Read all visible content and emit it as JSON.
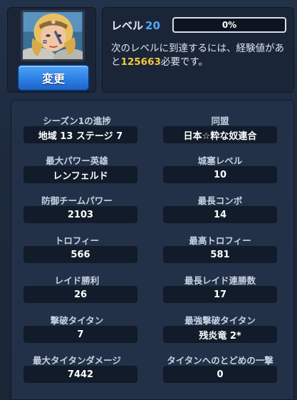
{
  "profile": {
    "change_button": "変更"
  },
  "level": {
    "label": "レベル",
    "value": "20",
    "progress_text": "0%",
    "progress_fraction": 0,
    "desc_prefix": "次のレベルに到達するには、経験値があと",
    "xp_remaining": "125663",
    "desc_suffix": "必要です。"
  },
  "stats": [
    {
      "label": "シーズン1の進捗",
      "value": "地域 13 ステージ 7"
    },
    {
      "label": "同盟",
      "value": "日本☆粋な奴連合"
    },
    {
      "label": "最大パワー英雄",
      "value": "レンフェルド"
    },
    {
      "label": "城塞レベル",
      "value": "10"
    },
    {
      "label": "防御チームパワー",
      "value": "2103"
    },
    {
      "label": "最長コンボ",
      "value": "14"
    },
    {
      "label": "トロフィー",
      "value": "566"
    },
    {
      "label": "最高トロフィー",
      "value": "581"
    },
    {
      "label": "レイド勝利",
      "value": "26"
    },
    {
      "label": "最長レイド連勝数",
      "value": "17"
    },
    {
      "label": "撃破タイタン",
      "value": "7"
    },
    {
      "label": "最強撃破タイタン",
      "value": "残炎竜 2*"
    },
    {
      "label": "最大タイタンダメージ",
      "value": "7442"
    },
    {
      "label": "タイタンへのとどめの一撃",
      "value": "0"
    }
  ]
}
